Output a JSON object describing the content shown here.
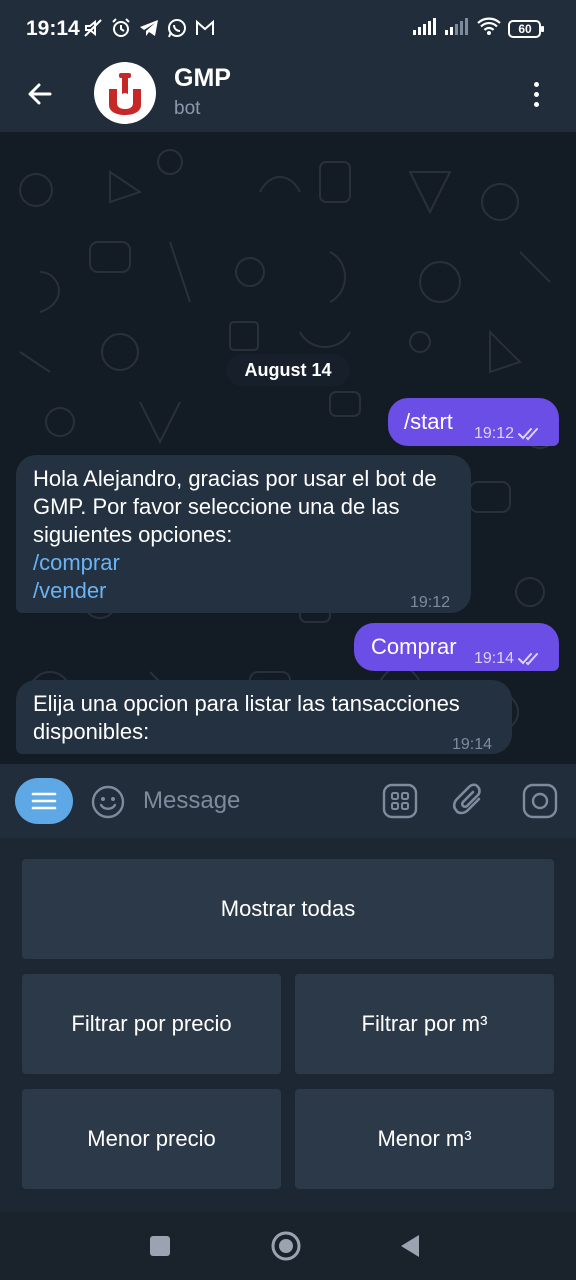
{
  "status_bar": {
    "time": "19:14",
    "battery": "60",
    "icons": [
      "mute-icon",
      "alarm-icon",
      "telegram-icon",
      "whatsapp-icon",
      "gmail-icon",
      "signal-icon",
      "signal-icon",
      "wifi-icon",
      "battery-icon"
    ]
  },
  "header": {
    "title": "GMP",
    "subtitle": "bot"
  },
  "chat": {
    "date": "August 14",
    "messages": [
      {
        "direction": "out",
        "text": "/start",
        "time": "19:12",
        "status": "read"
      },
      {
        "direction": "in",
        "text": "Hola Alejandro, gracias por usar el bot de GMP. Por favor seleccione una de las siguientes opciones:",
        "commands": [
          "/comprar",
          "/vender"
        ],
        "time": "19:12"
      },
      {
        "direction": "out",
        "text": "Comprar",
        "time": "19:14",
        "status": "read"
      },
      {
        "direction": "in",
        "text": "Elija una opcion para listar las tansacciones disponibles:",
        "time": "19:14"
      }
    ]
  },
  "input": {
    "placeholder": "Message"
  },
  "keyboard": {
    "buttons": [
      {
        "label": "Mostrar todas"
      },
      {
        "label": "Filtrar por precio"
      },
      {
        "label": "Filtrar por m³"
      },
      {
        "label": "Menor precio"
      },
      {
        "label": "Menor m³"
      }
    ]
  },
  "colors": {
    "outgoing_bubble": "#6a4ee6",
    "incoming_bubble": "#243141",
    "link": "#6ab3f3",
    "header": "#212d3b",
    "keyboard_button": "#2b3948"
  }
}
